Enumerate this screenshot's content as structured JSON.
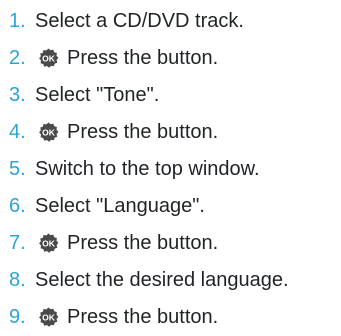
{
  "steps": [
    {
      "number": "1.",
      "text": "Select a CD/DVD track.",
      "icon": null
    },
    {
      "number": "2.",
      "text": "Press the button.",
      "icon": "ok-button-icon"
    },
    {
      "number": "3.",
      "text": "Select \"Tone\".",
      "icon": null
    },
    {
      "number": "4.",
      "text": "Press the button.",
      "icon": "ok-button-icon"
    },
    {
      "number": "5.",
      "text": "Switch to the top window.",
      "icon": null
    },
    {
      "number": "6.",
      "text": "Select \"Language\".",
      "icon": null
    },
    {
      "number": "7.",
      "text": "Press the button.",
      "icon": "ok-button-icon"
    },
    {
      "number": "8.",
      "text": "Select the desired language.",
      "icon": null
    },
    {
      "number": "9.",
      "text": "Press the button.",
      "icon": "ok-button-icon"
    }
  ],
  "icons": {
    "ok_label": "OK"
  },
  "colors": {
    "step_number": "#2aa3d8",
    "text": "#1f2328",
    "ok_icon_fill": "#4a4a4a"
  }
}
